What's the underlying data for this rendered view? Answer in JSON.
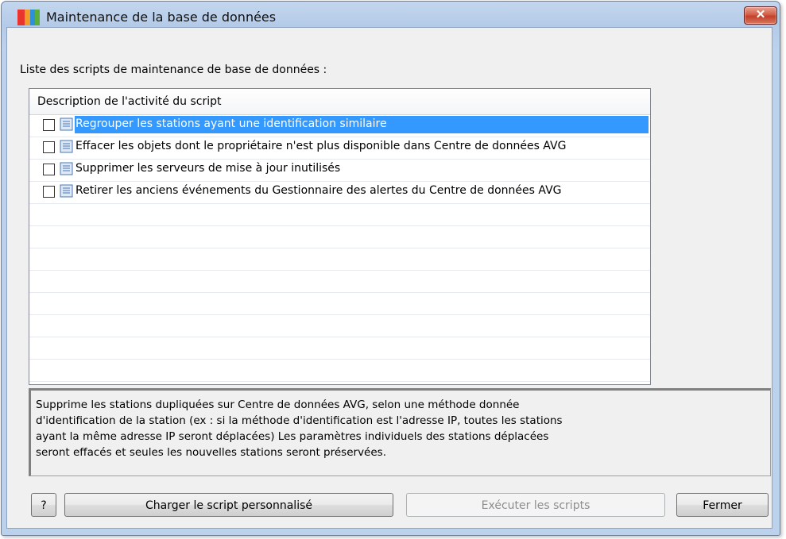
{
  "window": {
    "title": "Maintenance de la base de données",
    "close_glyph": "✕"
  },
  "list": {
    "label": "Liste des scripts de maintenance de base de données :",
    "column_header": "Description de l'activité du script",
    "items": [
      {
        "label": "Regrouper les stations ayant une identification similaire",
        "checked": false,
        "selected": true
      },
      {
        "label": "Effacer les objets dont le propriétaire n'est plus disponible dans Centre de données AVG",
        "checked": false,
        "selected": false
      },
      {
        "label": "Supprimer les serveurs de mise à jour inutilisés",
        "checked": false,
        "selected": false
      },
      {
        "label": "Retirer les anciens événements du Gestionnaire des alertes du Centre de données AVG",
        "checked": false,
        "selected": false
      }
    ]
  },
  "description": {
    "lines": [
      "Supprime les stations dupliquées sur Centre de données AVG, selon une méthode donnée",
      "d'identification de la station (ex : si la méthode d'identification est l'adresse IP, toutes les stations",
      "ayant la même adresse IP seront déplacées) Les paramètres individuels des stations déplacées",
      "seront effacés et seules les nouvelles stations seront préservées."
    ]
  },
  "buttons": {
    "help": "?",
    "load_custom": "Charger le script personnalisé",
    "run": "Exécuter les scripts",
    "close": "Fermer"
  },
  "colors": {
    "selection": "#3399ff",
    "close_button": "#c2402a"
  }
}
